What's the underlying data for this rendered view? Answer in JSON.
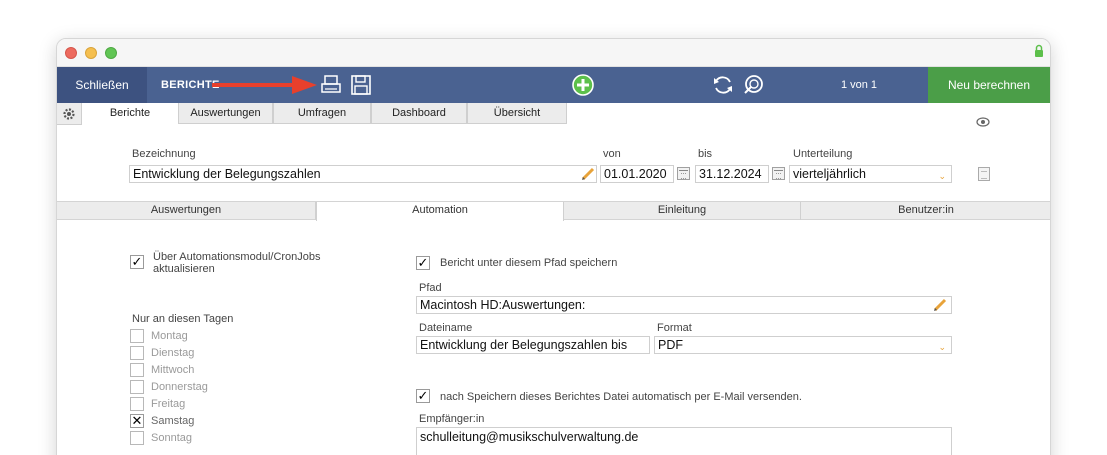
{
  "toolbar": {
    "close_label": "Schließen",
    "module_label": "BERICHTE",
    "page_count": "1 von 1",
    "recalc_label": "Neu berechnen",
    "icons": [
      "printer-icon",
      "save-icon",
      "add-icon",
      "refresh-icon",
      "search-icon"
    ]
  },
  "colors": {
    "toolbar": "#4a6291",
    "close_button": "#3d5280",
    "recalc_button": "#4b9e48",
    "add_icon": "#5cc04a",
    "arrow": "#e8402c",
    "accent_chevron": "#e8a33a"
  },
  "main_tabs": [
    {
      "label": "Berichte",
      "active": true
    },
    {
      "label": "Auswertungen",
      "active": false
    },
    {
      "label": "Umfragen",
      "active": false
    },
    {
      "label": "Dashboard",
      "active": false
    },
    {
      "label": "Übersicht",
      "active": false
    }
  ],
  "header": {
    "name_label": "Bezeichnung",
    "name_value": "Entwicklung der Belegungszahlen",
    "from_label": "von",
    "from_value": "01.01.2020",
    "to_label": "bis",
    "to_value": "31.12.2024",
    "division_label": "Unterteilung",
    "division_value": "vierteljährlich"
  },
  "sub_tabs": [
    {
      "label": "Auswertungen",
      "active": false
    },
    {
      "label": "Automation",
      "active": true
    },
    {
      "label": "Einleitung",
      "active": false
    },
    {
      "label": "Benutzer:in",
      "active": false
    }
  ],
  "automation": {
    "cron_label_line1": "Über Automationsmodul/CronJobs",
    "cron_label_line2": "aktualisieren",
    "cron_checked": true,
    "days_label": "Nur an diesen Tagen",
    "days": [
      {
        "label": "Montag",
        "checked": false
      },
      {
        "label": "Dienstag",
        "checked": false
      },
      {
        "label": "Mittwoch",
        "checked": false
      },
      {
        "label": "Donnerstag",
        "checked": false
      },
      {
        "label": "Freitag",
        "checked": false
      },
      {
        "label": "Samstag",
        "checked": true
      },
      {
        "label": "Sonntag",
        "checked": false
      }
    ],
    "save_path_label": "Bericht unter diesem Pfad speichern",
    "save_path_checked": true,
    "path_label": "Pfad",
    "path_value": "Macintosh HD:Auswertungen:",
    "filename_label": "Dateiname",
    "filename_value": "Entwicklung der Belegungszahlen bis",
    "format_label": "Format",
    "format_value": "PDF",
    "email_label": "nach Speichern dieses Berichtes Datei automatisch per E-Mail versenden.",
    "email_checked": true,
    "recipient_label": "Empfänger:in",
    "recipient_value": "schulleitung@musikschulverwaltung.de"
  }
}
